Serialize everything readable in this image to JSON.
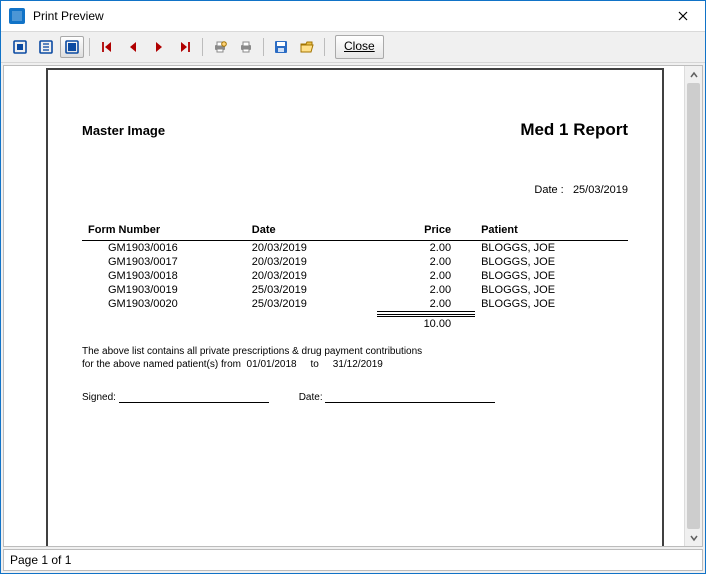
{
  "window": {
    "title": "Print Preview"
  },
  "toolbar": {
    "close_label": "Close"
  },
  "report": {
    "left_title": "Master Image",
    "right_title": "Med 1 Report",
    "date_label": "Date  :",
    "date_value": "25/03/2019",
    "columns": {
      "form": "Form Number",
      "date": "Date",
      "price": "Price",
      "patient": "Patient"
    },
    "rows": [
      {
        "form": "GM1903/0016",
        "date": "20/03/2019",
        "price": "2.00",
        "patient": "BLOGGS, JOE"
      },
      {
        "form": "GM1903/0017",
        "date": "20/03/2019",
        "price": "2.00",
        "patient": "BLOGGS, JOE"
      },
      {
        "form": "GM1903/0018",
        "date": "20/03/2019",
        "price": "2.00",
        "patient": "BLOGGS, JOE"
      },
      {
        "form": "GM1903/0019",
        "date": "25/03/2019",
        "price": "2.00",
        "patient": "BLOGGS, JOE"
      },
      {
        "form": "GM1903/0020",
        "date": "25/03/2019",
        "price": "2.00",
        "patient": "BLOGGS, JOE"
      }
    ],
    "total": "10.00",
    "note_line1": "The above list contains all private prescriptions & drug payment contributions",
    "note_line2_prefix": "for the above named patient(s) from",
    "note_from": "01/01/2018",
    "note_to_label": "to",
    "note_to": "31/12/2019",
    "signed_label": "Signed:",
    "date2_label": "Date:"
  },
  "status": {
    "text": "Page 1 of 1"
  }
}
